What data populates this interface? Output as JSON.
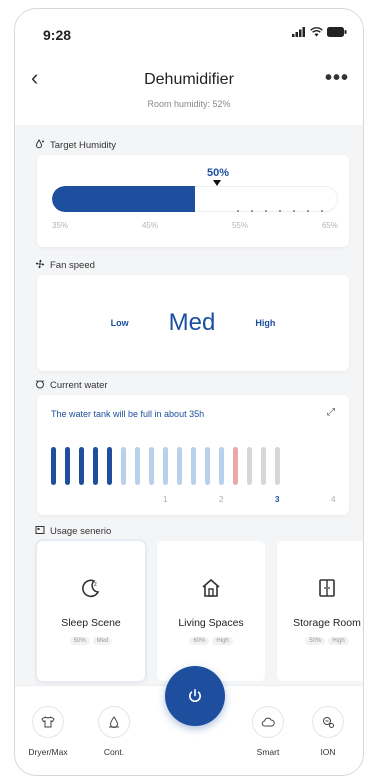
{
  "status_bar": {
    "time": "9:28"
  },
  "header": {
    "title": "Dehumidifier",
    "subtitle": "Room humidity: 52%",
    "more": "•••"
  },
  "target_humidity": {
    "label": "Target Humidity",
    "value_label": "50%",
    "value": 50,
    "min": 35,
    "max": 65,
    "scale": [
      "35%",
      "45%",
      "55%",
      "65%"
    ]
  },
  "fan_speed": {
    "label": "Fan speed",
    "low": "Low",
    "current": "Med",
    "high": "High"
  },
  "current_water": {
    "label": "Current water",
    "message": "The water tank will be full in about 35h",
    "bar_labels": [
      "1",
      "2",
      "3",
      "4"
    ],
    "active_label": "3"
  },
  "usage": {
    "label": "Usage senerio",
    "scenes": [
      {
        "name": "Sleep Scene",
        "tags": [
          "50%",
          "Med"
        ],
        "active": true
      },
      {
        "name": "Living Spaces",
        "tags": [
          "60%",
          "High"
        ],
        "active": false
      },
      {
        "name": "Storage Room",
        "tags": [
          "50%",
          "High"
        ],
        "active": false
      }
    ]
  },
  "bottom_bar": {
    "dryer": "Dryer/Max",
    "cont": "Cont.",
    "smart": "Smart",
    "ion": "ION"
  },
  "colors": {
    "accent": "#1e4f9f",
    "light_bar": "#b9d0ec",
    "red_bar": "#e7a9a9",
    "grey_bar": "#d5d7da"
  }
}
